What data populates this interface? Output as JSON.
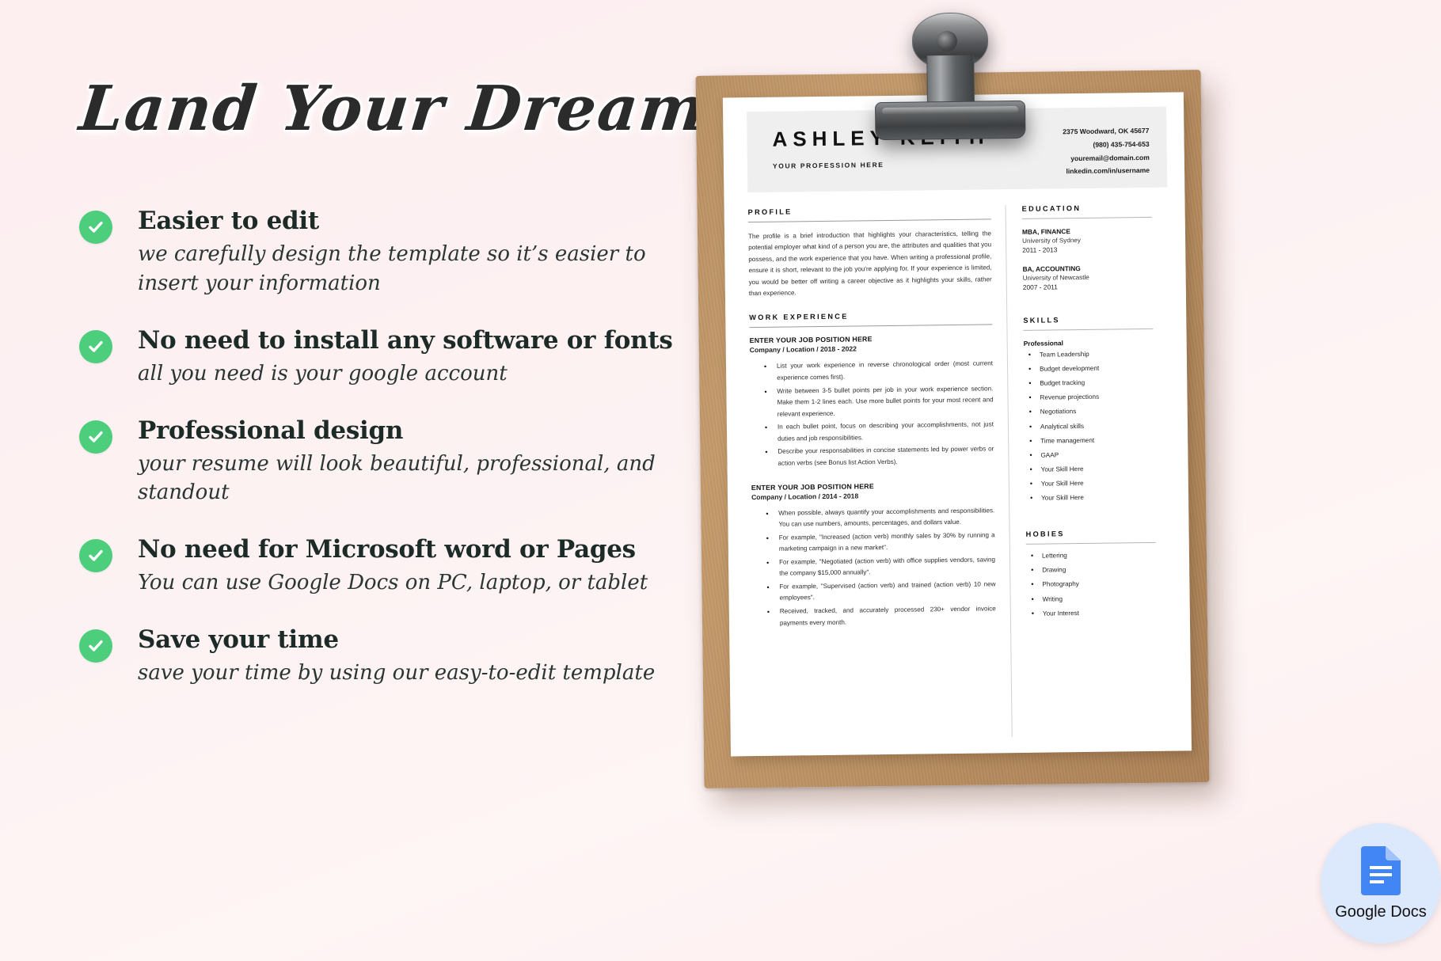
{
  "headline": "Land Your Dream Job!",
  "features": [
    {
      "icon": "check-circle-icon",
      "title": "Easier to edit",
      "sub": "we carefully design the template so it’s easier to insert your information"
    },
    {
      "icon": "check-circle-icon",
      "title": "No need to install any software or fonts",
      "sub": "all you need is your google account"
    },
    {
      "icon": "check-circle-icon",
      "title": "Professional design",
      "sub": "your resume will look beautiful, professional,  and standout"
    },
    {
      "icon": "check-circle-icon",
      "title": "No need for Microsoft word or Pages",
      "sub": "You can use Google Docs on PC, laptop, or tablet"
    },
    {
      "icon": "check-circle-icon",
      "title": "Save your time",
      "sub": "save your time by using our easy-to-edit template"
    }
  ],
  "resume": {
    "name": "ASHLEY KEITH",
    "profession": "YOUR PROFESSION HERE",
    "contact": {
      "address": "2375 Woodward, OK 45677",
      "phone": "(980) 435-754-653",
      "email": "youremail@domain.com",
      "linkedin": "linkedin.com/in/username"
    },
    "profile": {
      "heading": "PROFILE",
      "text": "The profile is a brief introduction that highlights your characteristics, telling the potential employer what kind of a person you are, the attributes and qualities that you possess, and the work experience that you have. When writing a professional profile, ensure it is short, relevant to the job you're applying for.  If your experience is limited, you would be better off writing a career objective as it highlights your skills, rather than experience."
    },
    "work": {
      "heading": "WORK EXPERIENCE",
      "jobs": [
        {
          "title": "ENTER YOUR JOB POSITION HERE",
          "meta": "Company / Location / 2018 - 2022",
          "bullets": [
            "List your work experience in reverse chronological order (most current experience comes first).",
            "Write between 3-5 bullet points per job in your work experience section. Make them 1-2 lines each. Use more bullet points for your most recent and relevant experience.",
            "In each bullet point, focus on describing your accomplishments, not just duties and job responsibilities.",
            "Describe your responsabilities in concise statements led by power verbs or action verbs (see Bonus list Action Verbs)."
          ]
        },
        {
          "title": "ENTER YOUR JOB POSITION HERE",
          "meta": "Company / Location / 2014 - 2018",
          "bullets": [
            "When possible, always quantify your accomplishments and responsibilities. You can use numbers, amounts, percentages, and dollars value.",
            "For example, \"Increased (action verb) monthly sales by 30% by running a marketing campaign in a new market\".",
            "For example, \"Negotiated (action verb) with office supplies vendors, saving the company $15,000 annually\".",
            "For example, \"Supervised (action verb) and trained (action verb) 10 new employees\".",
            "Received, tracked, and accurately processed 230+ vendor invoice payments every month."
          ]
        }
      ]
    },
    "education": {
      "heading": "EDUCATION",
      "items": [
        {
          "degree": "MBA, FINANCE",
          "school": "University of Sydney",
          "years": "2011 - 2013"
        },
        {
          "degree": "BA, ACCOUNTING",
          "school": "University of Newcastle",
          "years": "2007 - 2011"
        }
      ]
    },
    "skills": {
      "heading": "SKILLS",
      "category": "Professional",
      "items": [
        "Team Leadership",
        "Budget development",
        "Budget tracking",
        "Revenue projections",
        "Negotiations",
        "Analytical skills",
        "Time management",
        "GAAP",
        "Your Skill Here",
        "Your Skill Here",
        "Your Skill Here"
      ]
    },
    "hobbies": {
      "heading": "HOBIES",
      "items": [
        "Lettering",
        "Drawing",
        "Photography",
        "Writing",
        "Your Interest"
      ]
    }
  },
  "badge": {
    "label": "Google Docs",
    "icon": "google-docs-icon"
  },
  "colors": {
    "background": "#fdeef0",
    "check_green": "#4cce7d",
    "board_brown": "#c39a6b",
    "badge_blue": "#dce8fb",
    "docs_blue": "#4285f4"
  }
}
